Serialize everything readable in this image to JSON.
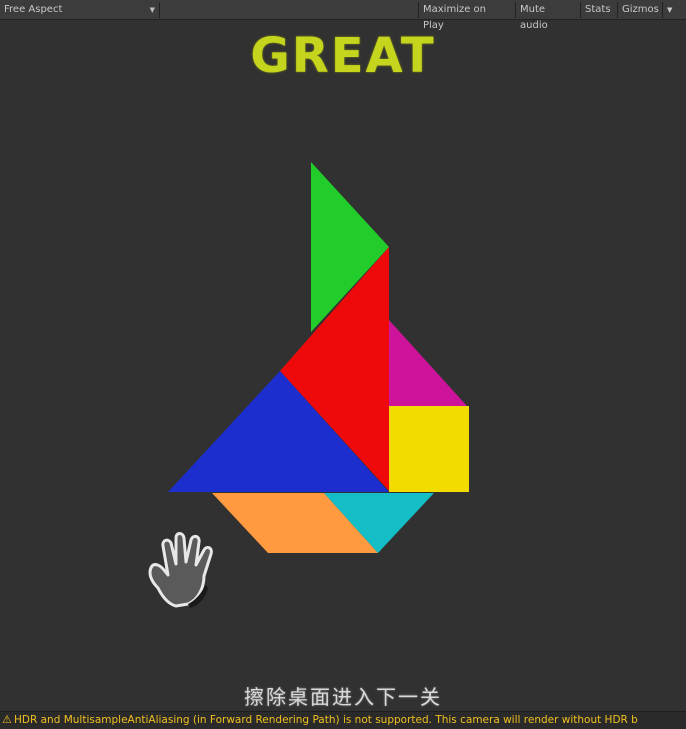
{
  "toolbar": {
    "aspect_label": "Free Aspect",
    "maximize_label": "Maximize on Play",
    "mute_label": "Mute audio",
    "stats_label": "Stats",
    "gizmos_label": "Gizmos"
  },
  "game": {
    "title": "GREAT",
    "instruction": "擦除桌面进入下一关",
    "pieces": [
      {
        "name": "green-triangle",
        "color": "#22cc2a"
      },
      {
        "name": "red-triangle",
        "color": "#ee0a0a"
      },
      {
        "name": "magenta-triangle",
        "color": "#cc1399"
      },
      {
        "name": "yellow-square",
        "color": "#f2dc00"
      },
      {
        "name": "blue-triangle",
        "color": "#1d2ecf"
      },
      {
        "name": "orange-parallelogram",
        "color": "#ff9a40"
      },
      {
        "name": "cyan-triangle",
        "color": "#14bec7"
      }
    ]
  },
  "status": {
    "warning_text": "HDR and MultisampleAntiAliasing (in Forward Rendering Path) is not supported. This camera will render without HDR b"
  }
}
